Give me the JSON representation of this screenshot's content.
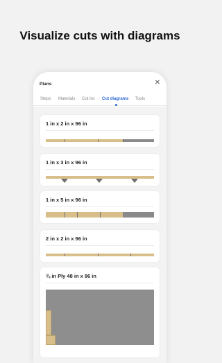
{
  "headline": "Visualize cuts with diagrams",
  "window": {
    "title": "Plans"
  },
  "tabs": [
    {
      "label": "Steps",
      "active": false
    },
    {
      "label": "Materials",
      "active": false
    },
    {
      "label": "Cut list",
      "active": false
    },
    {
      "label": "Cut diagrams",
      "active": true
    },
    {
      "label": "Tools",
      "active": false
    }
  ],
  "cards": [
    {
      "label": "1 in x 2 in x 96 in",
      "used_fraction": 0.71,
      "waste_fraction": 0.29
    },
    {
      "label": "1 in x 3 in x 96 in",
      "used_fraction": 1.0,
      "waste_fraction": 0.0
    },
    {
      "label": "1 in x 5 in x 96 in",
      "used_fraction": 0.71,
      "waste_fraction": 0.29
    },
    {
      "label": "2 in x 2 in x 96 in",
      "used_fraction": 1.0,
      "waste_fraction": 0.0
    },
    {
      "label": "¾ in Ply 48 in x 96 in"
    }
  ],
  "colors": {
    "wood": "#d8bf8a",
    "waste": "#8a8a8a",
    "accent": "#2a66d6",
    "background": "#f2f2f2"
  },
  "icons": {
    "close": "close-icon"
  }
}
